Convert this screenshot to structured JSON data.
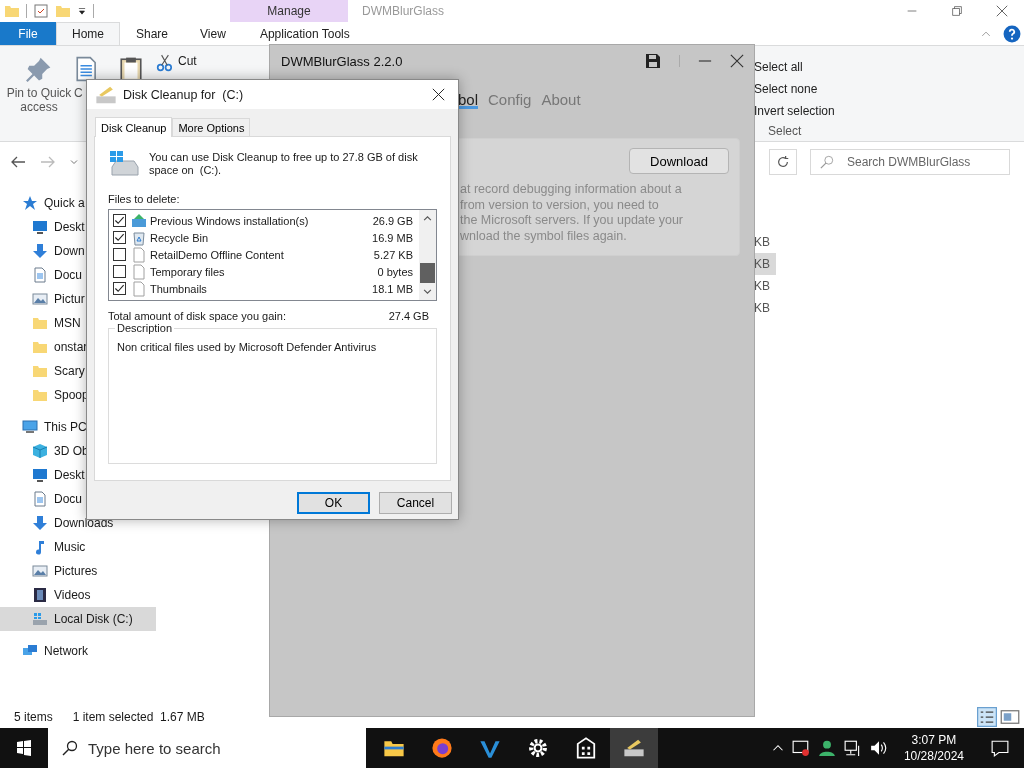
{
  "explorer": {
    "title": "DWMBlurGlass",
    "context_header": "Manage",
    "tabs": [
      {
        "label": "File",
        "kind": "file",
        "selected": false
      },
      {
        "label": "Home",
        "kind": "tab",
        "selected": true
      },
      {
        "label": "Share",
        "kind": "tab",
        "selected": false
      },
      {
        "label": "View",
        "kind": "tab",
        "selected": false
      },
      {
        "label": "Application Tools",
        "kind": "context",
        "selected": false
      }
    ],
    "ribbon": {
      "pin": "Pin to Quick access",
      "copy": "C",
      "cut": "Cut",
      "select_commands": [
        "Select all",
        "Select none",
        "Invert selection"
      ],
      "select_group": "Select"
    },
    "search": {
      "placeholder": "Search DWMBlurGlass"
    },
    "nav": [
      {
        "label": "Quick a",
        "kind": "star",
        "selected": false,
        "children": [
          {
            "label": "Deskt",
            "kind": "desktop",
            "selected": false
          },
          {
            "label": "Down",
            "kind": "download",
            "selected": false
          },
          {
            "label": "Docu",
            "kind": "document",
            "selected": false
          },
          {
            "label": "Pictur",
            "kind": "pictures",
            "selected": false
          },
          {
            "label": "MSN",
            "kind": "folder",
            "selected": false
          },
          {
            "label": "onstar",
            "kind": "folder",
            "selected": false
          },
          {
            "label": "Scary",
            "kind": "folder",
            "selected": false
          },
          {
            "label": "Spoop",
            "kind": "folder",
            "selected": false
          }
        ]
      },
      {
        "label": "This PC",
        "kind": "pc",
        "selected": false,
        "children": [
          {
            "label": "3D Ob",
            "kind": "cube",
            "selected": false
          },
          {
            "label": "Deskt",
            "kind": "desktop",
            "selected": false
          },
          {
            "label": "Docu",
            "kind": "document",
            "selected": false
          },
          {
            "label": "Downloads",
            "kind": "download",
            "selected": false
          },
          {
            "label": "Music",
            "kind": "music",
            "selected": false
          },
          {
            "label": "Pictures",
            "kind": "pictures",
            "selected": false
          },
          {
            "label": "Videos",
            "kind": "video",
            "selected": false
          },
          {
            "label": "Local Disk (C:)",
            "kind": "drive",
            "selected": true
          }
        ]
      },
      {
        "label": "Network",
        "kind": "network",
        "selected": false
      }
    ],
    "file_sizes": [
      {
        "text": "KB",
        "selected": false
      },
      {
        "text": "KB",
        "selected": true
      },
      {
        "text": "KB",
        "selected": false
      },
      {
        "text": "KB",
        "selected": false
      }
    ],
    "status": {
      "count": "5 items",
      "selection": "1 item selected  1.67 MB"
    }
  },
  "dwm": {
    "title": "DWMBlurGlass 2.2.0",
    "tabs": [
      {
        "label": "bol",
        "selected": true
      },
      {
        "label": "Config",
        "selected": false
      },
      {
        "label": "About",
        "selected": false
      }
    ],
    "download": "Download",
    "description_lines": [
      "at record debugging information about a",
      "from version to version, you need to",
      "the Microsoft servers. If you update your",
      "wnload the symbol files again."
    ]
  },
  "dialog": {
    "title": "Disk Cleanup for  (C:)",
    "tabs": [
      {
        "label": "Disk Cleanup",
        "selected": true
      },
      {
        "label": "More Options",
        "selected": false
      }
    ],
    "intro": "You can use Disk Cleanup to free up to 27.8 GB of disk space on  (C:).",
    "files_label": "Files to delete:",
    "files": [
      {
        "name": "Previous Windows installation(s)",
        "size": "26.9 GB",
        "kind": "windows",
        "checked": true
      },
      {
        "name": "Recycle Bin",
        "size": "16.9 MB",
        "kind": "recycle",
        "checked": true
      },
      {
        "name": "RetailDemo Offline Content",
        "size": "5.27 KB",
        "kind": "file",
        "checked": false
      },
      {
        "name": "Temporary files",
        "size": "0 bytes",
        "kind": "file",
        "checked": false
      },
      {
        "name": "Thumbnails",
        "size": "18.1 MB",
        "kind": "file",
        "checked": true
      }
    ],
    "total_label": "Total amount of disk space you gain:",
    "total": "27.4 GB",
    "description_title": "Description",
    "description": "Non critical files used by Microsoft Defender Antivirus",
    "buttons": [
      {
        "label": "OK",
        "kind": "default"
      },
      {
        "label": "Cancel",
        "kind": "normal"
      }
    ]
  },
  "taskbar": {
    "search_placeholder": "Type here to search",
    "apps": [
      {
        "kind": "folder",
        "active": false
      },
      {
        "kind": "firefox",
        "active": false
      },
      {
        "kind": "vs",
        "active": false
      },
      {
        "kind": "gear",
        "active": false
      },
      {
        "kind": "calculator",
        "active": false
      },
      {
        "kind": "cleanup",
        "active": true
      }
    ],
    "time": "3:07 PM",
    "date": "10/28/2024"
  }
}
